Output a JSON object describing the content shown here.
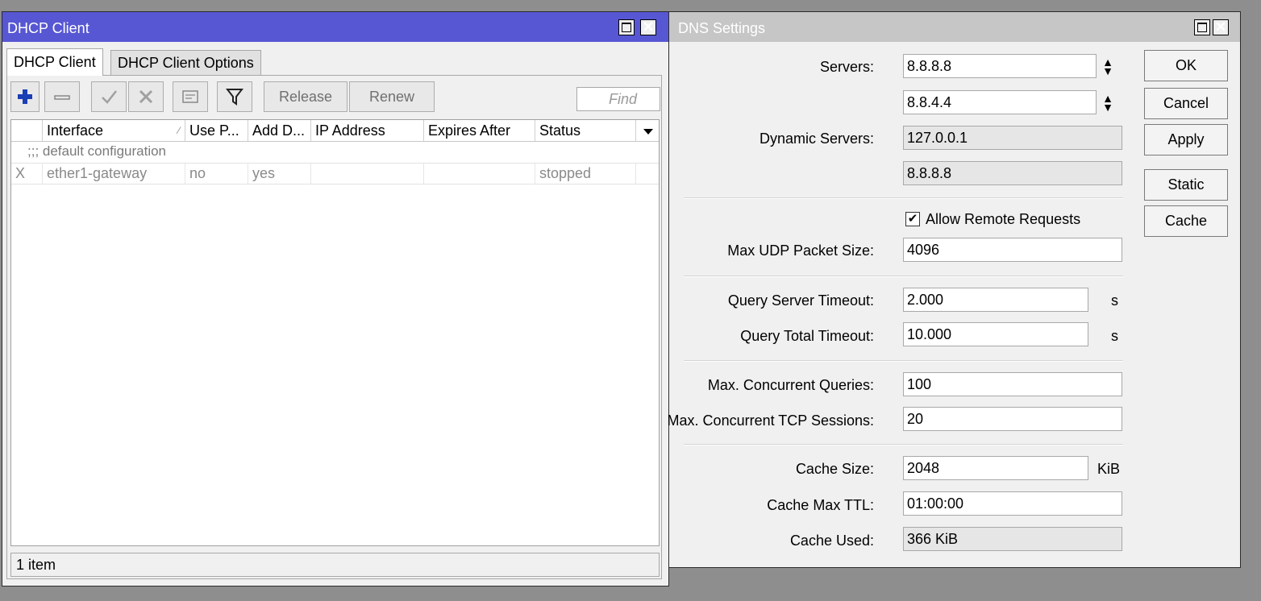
{
  "dhcp_window": {
    "title": "DHCP Client",
    "tabs": [
      "DHCP Client",
      "DHCP Client Options"
    ],
    "toolbar": {
      "release_label": "Release",
      "renew_label": "Renew",
      "find_placeholder": "Find"
    },
    "columns": [
      "Interface",
      "Use P...",
      "Add D...",
      "IP Address",
      "Expires After",
      "Status"
    ],
    "group_comment": ";;; default configuration",
    "rows": [
      {
        "flag": "X",
        "interface": "ether1-gateway",
        "use_peer_dns": "no",
        "add_default_route": "yes",
        "ip_address": "",
        "expires_after": "",
        "status": "stopped"
      }
    ],
    "status_text": "1 item"
  },
  "dns_window": {
    "title": "DNS Settings",
    "labels": {
      "servers": "Servers:",
      "dynamic_servers": "Dynamic Servers:",
      "max_udp": "Max UDP Packet Size:",
      "query_server_timeout": "Query Server Timeout:",
      "query_total_timeout": "Query Total Timeout:",
      "max_concurrent_queries": "Max. Concurrent Queries:",
      "max_concurrent_tcp": "Max. Concurrent TCP Sessions:",
      "cache_size": "Cache Size:",
      "cache_max_ttl": "Cache Max TTL:",
      "cache_used": "Cache Used:"
    },
    "values": {
      "server_1": "8.8.8.8",
      "server_2": "8.8.4.4",
      "dynamic_server_1": "127.0.0.1",
      "dynamic_server_2": "8.8.8.8",
      "max_udp": "4096",
      "query_server_timeout": "2.000",
      "query_total_timeout": "10.000",
      "max_concurrent_queries": "100",
      "max_concurrent_tcp": "20",
      "cache_size": "2048",
      "cache_max_ttl": "01:00:00",
      "cache_used": "366 KiB"
    },
    "units": {
      "seconds": "s",
      "kib": "KiB"
    },
    "allow_remote_requests": {
      "label": "Allow Remote Requests",
      "checked": true
    },
    "buttons": {
      "ok": "OK",
      "cancel": "Cancel",
      "apply": "Apply",
      "static": "Static",
      "cache": "Cache"
    }
  },
  "colors": {
    "dhcp_titlebar": "#5757d3",
    "dns_titlebar": "#c6c6c6",
    "desktop": "#8e8e8e",
    "add_icon": "#1a3fb5"
  }
}
